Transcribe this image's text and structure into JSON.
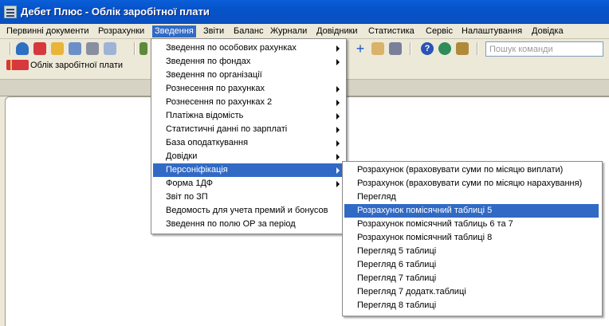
{
  "window": {
    "title": "Дебет Плюс - Облік заробітної плати"
  },
  "menubar": {
    "items": [
      "Первинні документи",
      "Розрахунки",
      "Зведення",
      "Звіти",
      "Баланс",
      "Журнали",
      "Довідники",
      "Статистика",
      "Сервіс",
      "Налаштування",
      "Довідка"
    ],
    "active": "Зведення"
  },
  "toolbar": {
    "icons": [
      "database-icon",
      "gift-icon",
      "percent-icon",
      "grid-icon",
      "edit-icon",
      "list-icon",
      "chart-icon",
      "crosshair-icon",
      "mail-icon",
      "save-icon",
      "help-icon",
      "globe-icon",
      "tools-icon"
    ],
    "search": {
      "placeholder": "Пошук команди",
      "value": ""
    }
  },
  "shortcut": {
    "label": "Облік заробітної плати"
  },
  "menu_main": {
    "items": [
      {
        "label": "Зведення по особових рахунках",
        "submenu": true
      },
      {
        "label": "Зведення по фондах",
        "submenu": true
      },
      {
        "label": "Зведення по організації",
        "submenu": false
      },
      {
        "label": "Рознесення по рахунках",
        "submenu": true
      },
      {
        "label": "Рознесення по рахунках 2",
        "submenu": true
      },
      {
        "label": "Платіжна відомість",
        "submenu": true
      },
      {
        "label": "Статистичні данні по зарплаті",
        "submenu": true
      },
      {
        "label": "База оподаткування",
        "submenu": true
      },
      {
        "label": "Довідки",
        "submenu": true
      },
      {
        "label": "Персоніфікація",
        "submenu": true,
        "highlighted": true
      },
      {
        "label": "Форма 1ДФ",
        "submenu": true
      },
      {
        "label": "Звіт по ЗП",
        "submenu": false
      },
      {
        "label": "Ведомость для учета премий и бонусов",
        "submenu": false
      },
      {
        "label": "Зведення по полю ОР за період",
        "submenu": false
      }
    ]
  },
  "menu_sub": {
    "items": [
      {
        "label": "Розрахунок (враховувати суми по місяцю виплати)"
      },
      {
        "label": "Розрахунок (враховувати суми по місяцю нарахування)"
      },
      {
        "label": "Перегляд"
      },
      {
        "label": "Розрахунок помісячний таблиці 5",
        "highlighted": true
      },
      {
        "label": "Розрахунок помісячний таблиць 6 та 7"
      },
      {
        "label": "Розрахунок помісячний таблиці 8"
      },
      {
        "label": "Перегляд 5 таблиці"
      },
      {
        "label": "Перегляд 6 таблиці"
      },
      {
        "label": "Перегляд 7 таблиці"
      },
      {
        "label": "Перегляд 7 додатк.таблиці"
      },
      {
        "label": "Перегляд 8 таблиці"
      }
    ]
  },
  "colors": {
    "title_bar": "#0653c8",
    "highlight": "#316ac5",
    "chrome": "#ece9d8"
  }
}
